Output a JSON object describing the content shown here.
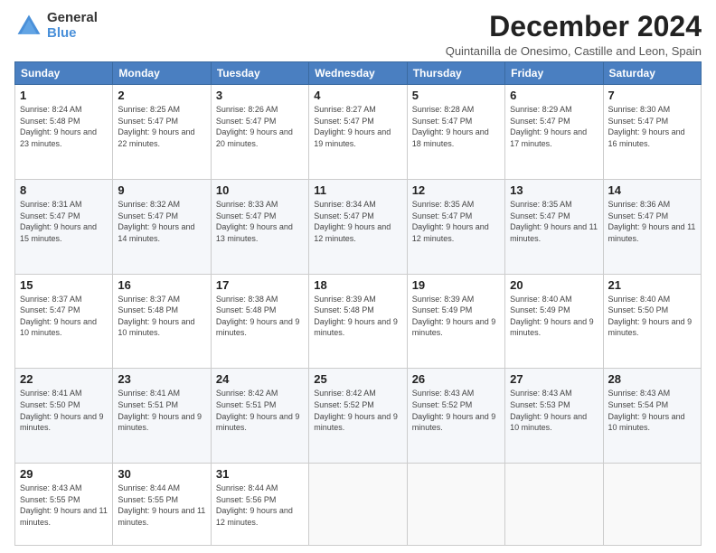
{
  "logo": {
    "general": "General",
    "blue": "Blue"
  },
  "title": "December 2024",
  "subtitle": "Quintanilla de Onesimo, Castille and Leon, Spain",
  "days_header": [
    "Sunday",
    "Monday",
    "Tuesday",
    "Wednesday",
    "Thursday",
    "Friday",
    "Saturday"
  ],
  "weeks": [
    [
      {
        "num": "1",
        "sunrise": "Sunrise: 8:24 AM",
        "sunset": "Sunset: 5:48 PM",
        "daylight": "Daylight: 9 hours and 23 minutes."
      },
      {
        "num": "2",
        "sunrise": "Sunrise: 8:25 AM",
        "sunset": "Sunset: 5:47 PM",
        "daylight": "Daylight: 9 hours and 22 minutes."
      },
      {
        "num": "3",
        "sunrise": "Sunrise: 8:26 AM",
        "sunset": "Sunset: 5:47 PM",
        "daylight": "Daylight: 9 hours and 20 minutes."
      },
      {
        "num": "4",
        "sunrise": "Sunrise: 8:27 AM",
        "sunset": "Sunset: 5:47 PM",
        "daylight": "Daylight: 9 hours and 19 minutes."
      },
      {
        "num": "5",
        "sunrise": "Sunrise: 8:28 AM",
        "sunset": "Sunset: 5:47 PM",
        "daylight": "Daylight: 9 hours and 18 minutes."
      },
      {
        "num": "6",
        "sunrise": "Sunrise: 8:29 AM",
        "sunset": "Sunset: 5:47 PM",
        "daylight": "Daylight: 9 hours and 17 minutes."
      },
      {
        "num": "7",
        "sunrise": "Sunrise: 8:30 AM",
        "sunset": "Sunset: 5:47 PM",
        "daylight": "Daylight: 9 hours and 16 minutes."
      }
    ],
    [
      {
        "num": "8",
        "sunrise": "Sunrise: 8:31 AM",
        "sunset": "Sunset: 5:47 PM",
        "daylight": "Daylight: 9 hours and 15 minutes."
      },
      {
        "num": "9",
        "sunrise": "Sunrise: 8:32 AM",
        "sunset": "Sunset: 5:47 PM",
        "daylight": "Daylight: 9 hours and 14 minutes."
      },
      {
        "num": "10",
        "sunrise": "Sunrise: 8:33 AM",
        "sunset": "Sunset: 5:47 PM",
        "daylight": "Daylight: 9 hours and 13 minutes."
      },
      {
        "num": "11",
        "sunrise": "Sunrise: 8:34 AM",
        "sunset": "Sunset: 5:47 PM",
        "daylight": "Daylight: 9 hours and 12 minutes."
      },
      {
        "num": "12",
        "sunrise": "Sunrise: 8:35 AM",
        "sunset": "Sunset: 5:47 PM",
        "daylight": "Daylight: 9 hours and 12 minutes."
      },
      {
        "num": "13",
        "sunrise": "Sunrise: 8:35 AM",
        "sunset": "Sunset: 5:47 PM",
        "daylight": "Daylight: 9 hours and 11 minutes."
      },
      {
        "num": "14",
        "sunrise": "Sunrise: 8:36 AM",
        "sunset": "Sunset: 5:47 PM",
        "daylight": "Daylight: 9 hours and 11 minutes."
      }
    ],
    [
      {
        "num": "15",
        "sunrise": "Sunrise: 8:37 AM",
        "sunset": "Sunset: 5:47 PM",
        "daylight": "Daylight: 9 hours and 10 minutes."
      },
      {
        "num": "16",
        "sunrise": "Sunrise: 8:37 AM",
        "sunset": "Sunset: 5:48 PM",
        "daylight": "Daylight: 9 hours and 10 minutes."
      },
      {
        "num": "17",
        "sunrise": "Sunrise: 8:38 AM",
        "sunset": "Sunset: 5:48 PM",
        "daylight": "Daylight: 9 hours and 9 minutes."
      },
      {
        "num": "18",
        "sunrise": "Sunrise: 8:39 AM",
        "sunset": "Sunset: 5:48 PM",
        "daylight": "Daylight: 9 hours and 9 minutes."
      },
      {
        "num": "19",
        "sunrise": "Sunrise: 8:39 AM",
        "sunset": "Sunset: 5:49 PM",
        "daylight": "Daylight: 9 hours and 9 minutes."
      },
      {
        "num": "20",
        "sunrise": "Sunrise: 8:40 AM",
        "sunset": "Sunset: 5:49 PM",
        "daylight": "Daylight: 9 hours and 9 minutes."
      },
      {
        "num": "21",
        "sunrise": "Sunrise: 8:40 AM",
        "sunset": "Sunset: 5:50 PM",
        "daylight": "Daylight: 9 hours and 9 minutes."
      }
    ],
    [
      {
        "num": "22",
        "sunrise": "Sunrise: 8:41 AM",
        "sunset": "Sunset: 5:50 PM",
        "daylight": "Daylight: 9 hours and 9 minutes."
      },
      {
        "num": "23",
        "sunrise": "Sunrise: 8:41 AM",
        "sunset": "Sunset: 5:51 PM",
        "daylight": "Daylight: 9 hours and 9 minutes."
      },
      {
        "num": "24",
        "sunrise": "Sunrise: 8:42 AM",
        "sunset": "Sunset: 5:51 PM",
        "daylight": "Daylight: 9 hours and 9 minutes."
      },
      {
        "num": "25",
        "sunrise": "Sunrise: 8:42 AM",
        "sunset": "Sunset: 5:52 PM",
        "daylight": "Daylight: 9 hours and 9 minutes."
      },
      {
        "num": "26",
        "sunrise": "Sunrise: 8:43 AM",
        "sunset": "Sunset: 5:52 PM",
        "daylight": "Daylight: 9 hours and 9 minutes."
      },
      {
        "num": "27",
        "sunrise": "Sunrise: 8:43 AM",
        "sunset": "Sunset: 5:53 PM",
        "daylight": "Daylight: 9 hours and 10 minutes."
      },
      {
        "num": "28",
        "sunrise": "Sunrise: 8:43 AM",
        "sunset": "Sunset: 5:54 PM",
        "daylight": "Daylight: 9 hours and 10 minutes."
      }
    ],
    [
      {
        "num": "29",
        "sunrise": "Sunrise: 8:43 AM",
        "sunset": "Sunset: 5:55 PM",
        "daylight": "Daylight: 9 hours and 11 minutes."
      },
      {
        "num": "30",
        "sunrise": "Sunrise: 8:44 AM",
        "sunset": "Sunset: 5:55 PM",
        "daylight": "Daylight: 9 hours and 11 minutes."
      },
      {
        "num": "31",
        "sunrise": "Sunrise: 8:44 AM",
        "sunset": "Sunset: 5:56 PM",
        "daylight": "Daylight: 9 hours and 12 minutes."
      },
      null,
      null,
      null,
      null
    ]
  ]
}
